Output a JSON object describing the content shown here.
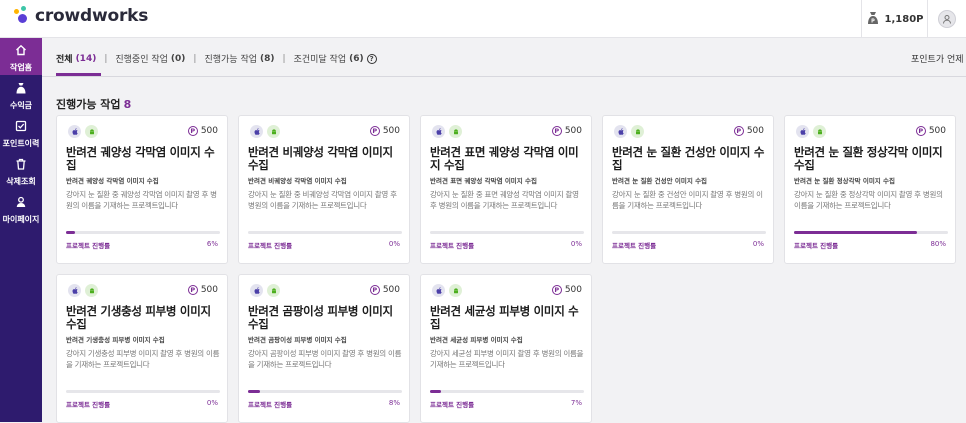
{
  "brand": {
    "name": "crowdworks"
  },
  "header": {
    "points": "1,180P"
  },
  "sidebar": {
    "items": [
      {
        "label": "작업홈",
        "icon": "home-icon"
      },
      {
        "label": "수익금",
        "icon": "money-bag-icon"
      },
      {
        "label": "포인트이력",
        "icon": "history-icon"
      },
      {
        "label": "삭제조회",
        "icon": "trash-icon"
      },
      {
        "label": "마이페이지",
        "icon": "user-icon"
      }
    ]
  },
  "tabs": [
    {
      "label": "전체",
      "count": "(14)"
    },
    {
      "label": "진행중인 작업",
      "count": "(0)"
    },
    {
      "label": "진행가능 작업",
      "count": "(8)"
    },
    {
      "label": "조건미달 작업",
      "count": "(6)"
    }
  ],
  "faq_link": "포인트가 언제 입",
  "section": {
    "title": "진행가능 작업",
    "count": "8"
  },
  "progress_label": "프로젝트 진행률",
  "cards": [
    {
      "reward": "500",
      "title": "반려견 궤양성 각막염 이미지 수집",
      "subtitle": "반려견 궤양성 각막염 이미지 수집",
      "desc": "강아지 눈 질환 중 궤양성 각막염 이미지 촬영 후 병원의 이름을 기재하는 프로젝트입니다",
      "progress": "6%"
    },
    {
      "reward": "500",
      "title": "반려견 비궤양성 각막염 이미지 수집",
      "subtitle": "반려견 비궤양성 각막염 이미지 수집",
      "desc": "강아지 눈 질환 중 비궤양성 각막염 이미지 촬영 후 병원의 이름을 기재하는 프로젝트입니다",
      "progress": "0%"
    },
    {
      "reward": "500",
      "title": "반려견 표면 궤양성 각막염 이미지 수집",
      "subtitle": "반려견 표면 궤양성 각막염 이미지 수집",
      "desc": "강아지 눈 질환 중 표면 궤양성 각막염 이미지 촬영 후 병원의 이름을 기재하는 프로젝트입니다",
      "progress": "0%"
    },
    {
      "reward": "500",
      "title": "반려견 눈 질환 건성안 이미지 수집",
      "subtitle": "반려견 눈 질환 건성안 이미지 수집",
      "desc": "강아지 눈 질환 중 건성안 이미지 촬영 후 병원의 이름을 기재하는 프로젝트입니다",
      "progress": "0%"
    },
    {
      "reward": "500",
      "title": "반려견 눈 질환 정상각막 이미지 수집",
      "subtitle": "반려견 눈 질환 정상각막 이미지 수집",
      "desc": "강아지 눈 질환 중 정상각막 이미지 촬영 후 병원의 이름을 기재하는 프로젝트입니다",
      "progress": "80%"
    },
    {
      "reward": "500",
      "title": "반려견 기생충성 피부병 이미지 수집",
      "subtitle": "반려견 기생충성 피부병 이미지 수집",
      "desc": "강아지 기생충성 피부병 이미지 촬영 후 병원의 이름을 기재하는 프로젝트입니다",
      "progress": "0%"
    },
    {
      "reward": "500",
      "title": "반려견 곰팡이성 피부병 이미지 수집",
      "subtitle": "반려견 곰팡이성 피부병 이미지 수집",
      "desc": "강아지 곰팡이성 피부병 이미지 촬영 후 병원의 이름을 기재하는 프로젝트입니다",
      "progress": "8%"
    },
    {
      "reward": "500",
      "title": "반려견 세균성 피부병 이미지 수집",
      "subtitle": "반려견 세균성 피부병 이미지 수집",
      "desc": "강아지 세균성 피부병 이미지 촬영 후 병원의 이름을 기재하는 프로젝트입니다",
      "progress": "7%"
    }
  ]
}
